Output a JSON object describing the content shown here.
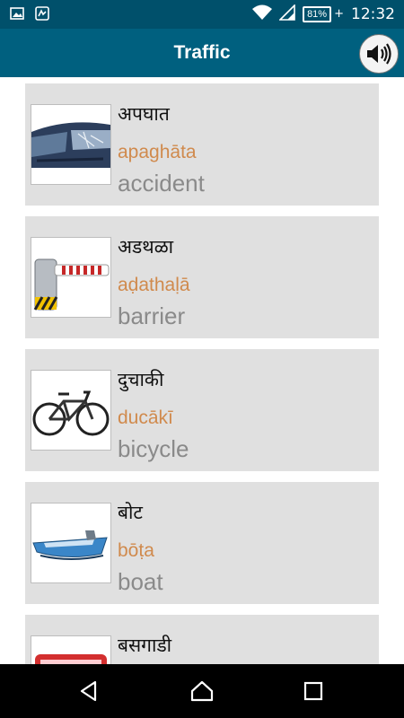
{
  "status_bar": {
    "battery": "81%",
    "time": "12:32",
    "left_icons": [
      "image-icon",
      "app-notification-icon"
    ],
    "right_icons": [
      "wifi-icon",
      "signal-icon",
      "battery-icon"
    ]
  },
  "app_bar": {
    "title": "Traffic",
    "speaker_icon": "speaker-icon"
  },
  "items": [
    {
      "word": "अपघात",
      "transliteration": "apaghāta",
      "english": "accident",
      "image": "crashed-car"
    },
    {
      "word": "अडथळा",
      "transliteration": "aḍathaḷā",
      "english": "barrier",
      "image": "road-barrier"
    },
    {
      "word": "दुचाकी",
      "transliteration": "ducākī",
      "english": "bicycle",
      "image": "bicycle"
    },
    {
      "word": "बोट",
      "transliteration": "bōṭa",
      "english": "boat",
      "image": "boat"
    },
    {
      "word": "बसगाडी",
      "transliteration": "",
      "english": "",
      "image": "bus"
    }
  ],
  "nav_bar": {
    "back": "back-icon",
    "home": "home-icon",
    "recents": "recents-icon"
  }
}
